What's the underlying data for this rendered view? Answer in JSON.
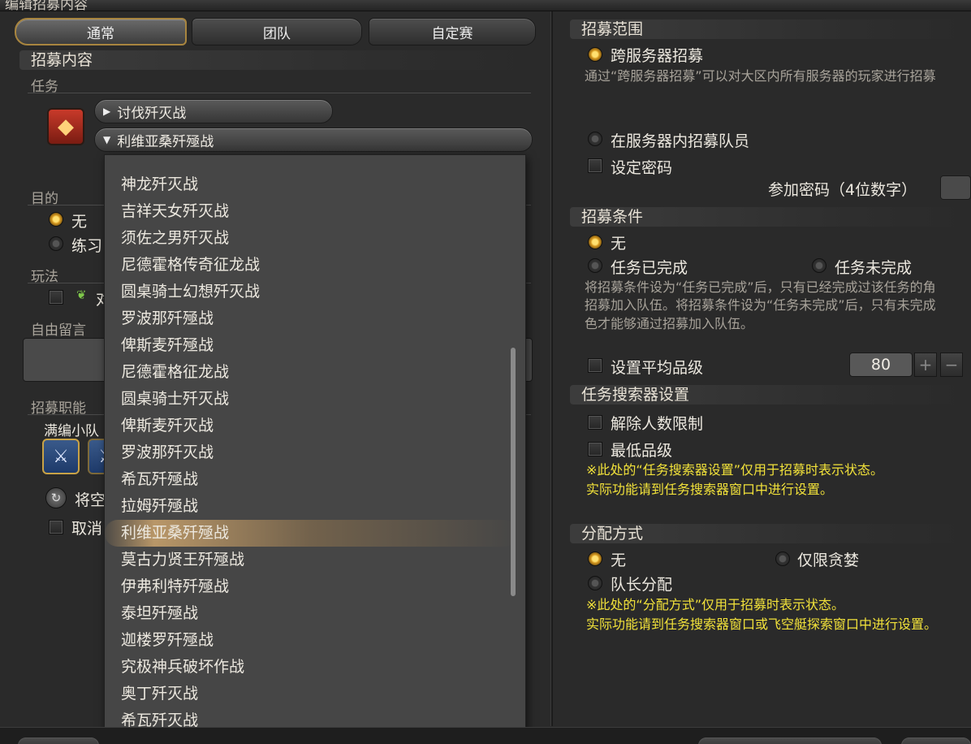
{
  "window": {
    "title": "编辑招募内容"
  },
  "tabs": [
    "通常",
    "团队",
    "自定赛"
  ],
  "left": {
    "content_header": "招募内容",
    "duty_label": "任务",
    "category_dropdown": "讨伐歼灭战",
    "duty_dropdown": "利维亚桑歼殛战",
    "purpose_label": "目的",
    "purpose_options": [
      "无",
      "练习"
    ],
    "playstyle_label": "玩法",
    "playstyle_check": "对",
    "comment_label": "自由留言",
    "jobs_label": "招募职能",
    "party_label": "满编小队",
    "action_text": "将空",
    "cancel_text": "取消"
  },
  "dropdown_items": [
    "神龙歼灭战",
    "吉祥天女歼灭战",
    "须佐之男歼灭战",
    "尼德霍格传奇征龙战",
    "圆桌骑士幻想歼灭战",
    "罗波那歼殛战",
    "俾斯麦歼殛战",
    "尼德霍格征龙战",
    "圆桌骑士歼灭战",
    "俾斯麦歼灭战",
    "罗波那歼灭战",
    "希瓦歼殛战",
    "拉姆歼殛战",
    "利维亚桑歼殛战",
    "莫古力贤王歼殛战",
    "伊弗利特歼殛战",
    "泰坦歼殛战",
    "迦楼罗歼殛战",
    "究极神兵破坏作战",
    "奥丁歼灭战",
    "希瓦歼灭战"
  ],
  "dropdown_selected_index": 13,
  "right": {
    "range_header": "招募范围",
    "cross_server": "跨服务器招募",
    "cross_server_note": "通过“跨服务器招募”可以对大区内所有服务器的玩家进行招募",
    "in_server": "在服务器内招募队员",
    "set_password": "设定密码",
    "password_label": "参加密码（4位数字）",
    "conditions_header": "招募条件",
    "cond_none": "无",
    "cond_completed": "任务已完成",
    "cond_incomplete": "任务未完成",
    "cond_note_1": "将招募条件设为“任务已完成”后，只有已经完成过该任务的角",
    "cond_note_2": "招募加入队伍。将招募条件设为“任务未完成”后，只有未完成",
    "cond_note_3": "色才能够通过招募加入队伍。",
    "avg_ilvl": "设置平均品级",
    "avg_ilvl_value": "80",
    "finder_header": "任务搜索器设置",
    "finder_unrestricted": "解除人数限制",
    "finder_min_ilvl": "最低品级",
    "finder_note_1": "※此处的“任务搜索器设置”仅用于招募时表示状态。",
    "finder_note_2": "实际功能请到任务搜索器窗口中进行设置。",
    "loot_header": "分配方式",
    "loot_none": "无",
    "loot_greed": "仅限贪婪",
    "loot_leader": "队长分配",
    "loot_note_1": "※此处的“分配方式”仅用于招募时表示状态。",
    "loot_note_2": "实际功能请到任务搜索器窗口或飞空艇探索窗口中进行设置。"
  },
  "icons": {
    "duty": "duty-ifrit-icon",
    "job": "job-icon",
    "refresh": "refresh-icon",
    "stepper_plus": "plus-icon",
    "stepper_minus": "minus-icon"
  },
  "colors": {
    "accent_gold": "#c8a246",
    "note_yellow": "#f2e23a",
    "selection": "#cda56e"
  }
}
